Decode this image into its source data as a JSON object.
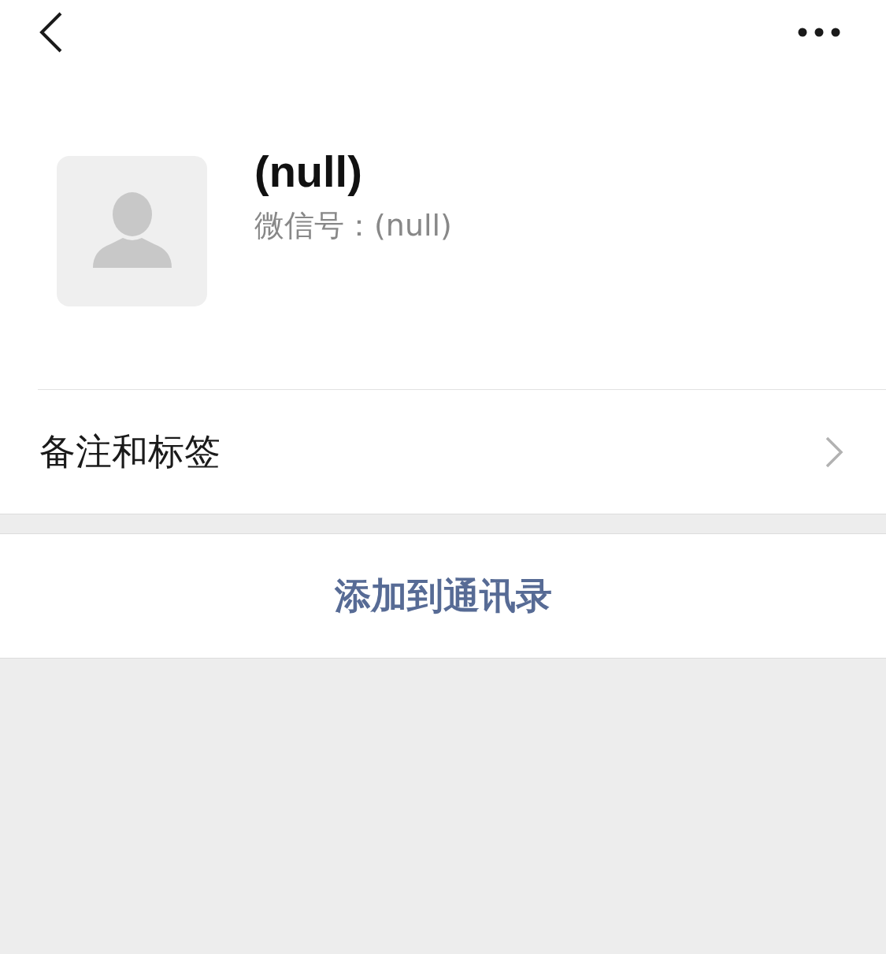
{
  "profile": {
    "name": "(null)",
    "wechat_id": "微信号：(null)"
  },
  "menu_row": {
    "label": "备注和标签"
  },
  "action": {
    "label": "添加到通讯录"
  }
}
